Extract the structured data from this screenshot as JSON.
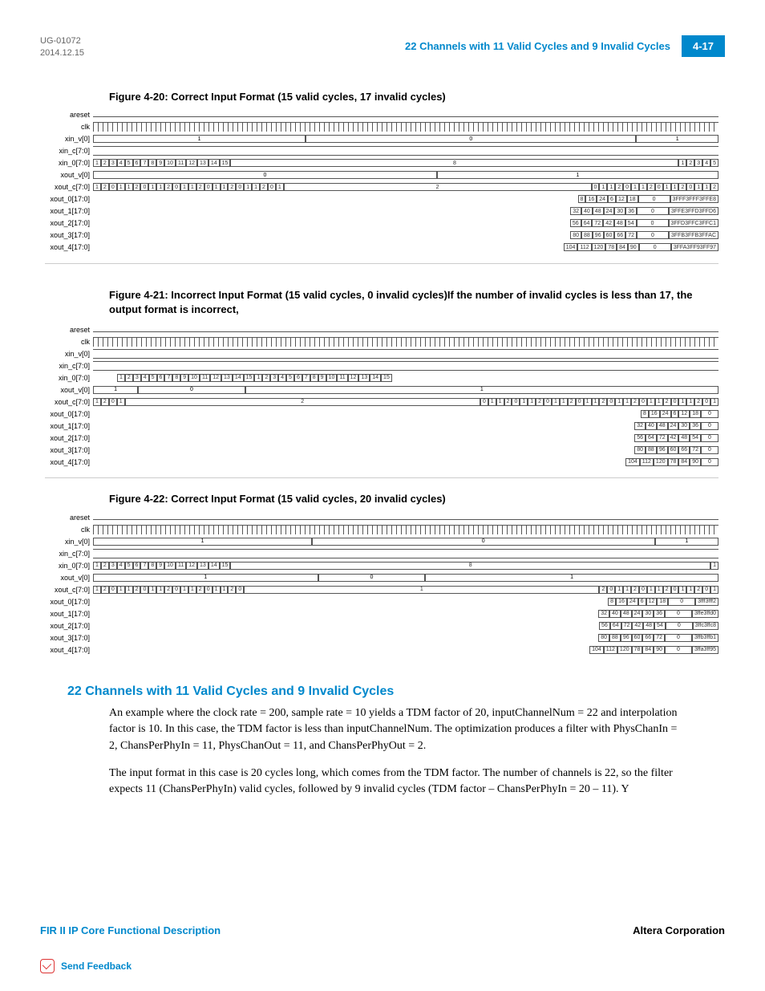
{
  "header": {
    "doc_id": "UG-01072",
    "date": "2014.12.15",
    "title": "22 Channels with 11 Valid Cycles and 9 Invalid Cycles",
    "page": "4-17"
  },
  "figures": {
    "f420": {
      "caption": "Figure 4-20: Correct Input Format (15 valid cycles, 17 invalid cycles)",
      "signals": [
        "areset",
        "clk",
        "xin_v[0]",
        "xin_c[7:0]",
        "xin_0[7:0]",
        "xout_v[0]",
        "xout_c[7:0]",
        "xout_0[17:0]",
        "xout_1[17:0]",
        "xout_2[17:0]",
        "xout_3[17:0]",
        "xout_4[17:0]"
      ],
      "xin0_row": [
        "1",
        "2",
        "3",
        "4",
        "5",
        "6",
        "7",
        "8",
        "9",
        "10",
        "11",
        "12",
        "13",
        "14",
        "15",
        "8",
        "1",
        "2",
        "3",
        "4",
        "5"
      ],
      "xin_v0_vals": [
        "1",
        "0",
        "1"
      ],
      "xoutv0_vals": [
        "0",
        "1"
      ],
      "xoutc_row": [
        "1",
        "2",
        "0",
        "1",
        "1",
        "2",
        "0",
        "1",
        "1",
        "2",
        "0",
        "1",
        "1",
        "2",
        "0",
        "1",
        "1",
        "2",
        "0",
        "1",
        "1",
        "2",
        "0",
        "1",
        "2",
        "0",
        "1",
        "1",
        "2",
        "0",
        "1",
        "1",
        "2",
        "0",
        "1",
        "1",
        "2",
        "0",
        "1",
        "1",
        "2"
      ],
      "xout0_row": [
        "8",
        "16",
        "24",
        "6",
        "12",
        "18",
        "0",
        "3FFF3FFF3FFE8"
      ],
      "xout1_row": [
        "32",
        "40",
        "48",
        "24",
        "30",
        "36",
        "0",
        "3FFE3FFD3FFD6"
      ],
      "xout2_row": [
        "56",
        "64",
        "72",
        "42",
        "48",
        "54",
        "0",
        "3FFD3FFC3FFC1"
      ],
      "xout3_row": [
        "80",
        "88",
        "96",
        "60",
        "66",
        "72",
        "0",
        "3FFB3FFB3FFAC"
      ],
      "xout4_row": [
        "104",
        "112",
        "120",
        "78",
        "84",
        "90",
        "0",
        "3FFA3FF93FF97"
      ]
    },
    "f421": {
      "caption": "Figure 4-21: Incorrect Input Format (15 valid cycles, 0 invalid cycles)If the number of invalid cycles is less than 17, the output format is incorrect,",
      "signals": [
        "areset",
        "clk",
        "xin_v[0]",
        "xin_c[7:0]",
        "xin_0[7:0]",
        "xout_v[0]",
        "xout_c[7:0]",
        "xout_0[17:0]",
        "xout_1[17:0]",
        "xout_2[17:0]",
        "xout_3[17:0]",
        "xout_4[17:0]"
      ],
      "xin0_row": [
        "1",
        "2",
        "3",
        "4",
        "5",
        "6",
        "7",
        "8",
        "9",
        "10",
        "11",
        "12",
        "13",
        "14",
        "15",
        "1",
        "2",
        "3",
        "4",
        "5",
        "6",
        "7",
        "8",
        "9",
        "10",
        "11",
        "12",
        "13",
        "14",
        "15"
      ],
      "xoutv0_vals": [
        "1",
        "0",
        "1"
      ],
      "xoutc_row": [
        "1",
        "2",
        "0",
        "1",
        "2",
        "0",
        "1",
        "1",
        "2",
        "0",
        "1",
        "1",
        "2",
        "0",
        "1",
        "1",
        "2",
        "0",
        "1",
        "1",
        "2",
        "0",
        "1",
        "1",
        "2",
        "0",
        "1",
        "1",
        "2",
        "0",
        "1",
        "1",
        "2",
        "0",
        "1"
      ],
      "xout0_row": [
        "8",
        "16",
        "24",
        "6",
        "12",
        "18",
        "0"
      ],
      "xout1_row": [
        "32",
        "40",
        "48",
        "24",
        "30",
        "36",
        "0"
      ],
      "xout2_row": [
        "56",
        "64",
        "72",
        "42",
        "48",
        "54",
        "0"
      ],
      "xout3_row": [
        "80",
        "88",
        "96",
        "60",
        "66",
        "72",
        "0"
      ],
      "xout4_row": [
        "104",
        "112",
        "120",
        "78",
        "84",
        "90",
        "0"
      ]
    },
    "f422": {
      "caption": "Figure 4-22: Correct Input Format (15 valid cycles, 20 invalid cycles)",
      "signals": [
        "areset",
        "clk",
        "xin_v[0]",
        "xin_c[7:0]",
        "xin_0[7:0]",
        "xout_v[0]",
        "xout_c[7:0]",
        "xout_0[17:0]",
        "xout_1[17:0]",
        "xout_2[17:0]",
        "xout_3[17:0]",
        "xout_4[17:0]"
      ],
      "xin0_row": [
        "1",
        "2",
        "3",
        "4",
        "5",
        "6",
        "7",
        "8",
        "9",
        "10",
        "11",
        "12",
        "13",
        "14",
        "15",
        "8",
        "1"
      ],
      "xin_v0_vals": [
        "1",
        "0",
        "1"
      ],
      "xoutv0_vals": [
        "1",
        "0",
        "1"
      ],
      "xoutc_row": [
        "1",
        "2",
        "0",
        "1",
        "1",
        "2",
        "0",
        "1",
        "1",
        "2",
        "0",
        "1",
        "1",
        "2",
        "0",
        "1",
        "1",
        "2",
        "0",
        "1",
        "2",
        "0",
        "1",
        "1",
        "2",
        "0",
        "1",
        "1",
        "2",
        "0",
        "1",
        "1",
        "2",
        "0",
        "1"
      ],
      "xout0_row": [
        "8",
        "16",
        "24",
        "6",
        "12",
        "18",
        "0",
        "3fff3fff2"
      ],
      "xout1_row": [
        "32",
        "40",
        "48",
        "24",
        "30",
        "36",
        "0",
        "3ffe3ffd0"
      ],
      "xout2_row": [
        "56",
        "64",
        "72",
        "42",
        "48",
        "54",
        "0",
        "3ffc3ffc8"
      ],
      "xout3_row": [
        "80",
        "88",
        "96",
        "60",
        "66",
        "72",
        "0",
        "3ffb3ffb1"
      ],
      "xout4_row": [
        "104",
        "112",
        "120",
        "78",
        "84",
        "90",
        "0",
        "3ffa3ff95"
      ]
    }
  },
  "section": {
    "title": "22 Channels with 11 Valid Cycles and 9 Invalid Cycles",
    "p1": "An example where the clock rate = 200, sample rate = 10 yields a TDM factor of 20, inputChannelNum = 22 and interpolation factor is 10. In this case, the TDM factor is less than inputChannelNum. The optimization produces a filter with PhysChanIn = 2, ChansPerPhyIn = 11, PhysChanOut = 11, and ChansPerPhyOut = 2.",
    "p2": "The input format in this case is 20 cycles long, which comes from the TDM factor. The number of channels is 22, so the filter expects 11 (ChansPerPhyIn) valid cycles, followed by 9 invalid cycles (TDM factor – ChansPerPhyIn = 20 – 11). Y"
  },
  "footer": {
    "left": "FIR II IP Core Functional Description",
    "right": "Altera Corporation",
    "feedback": "Send Feedback"
  }
}
